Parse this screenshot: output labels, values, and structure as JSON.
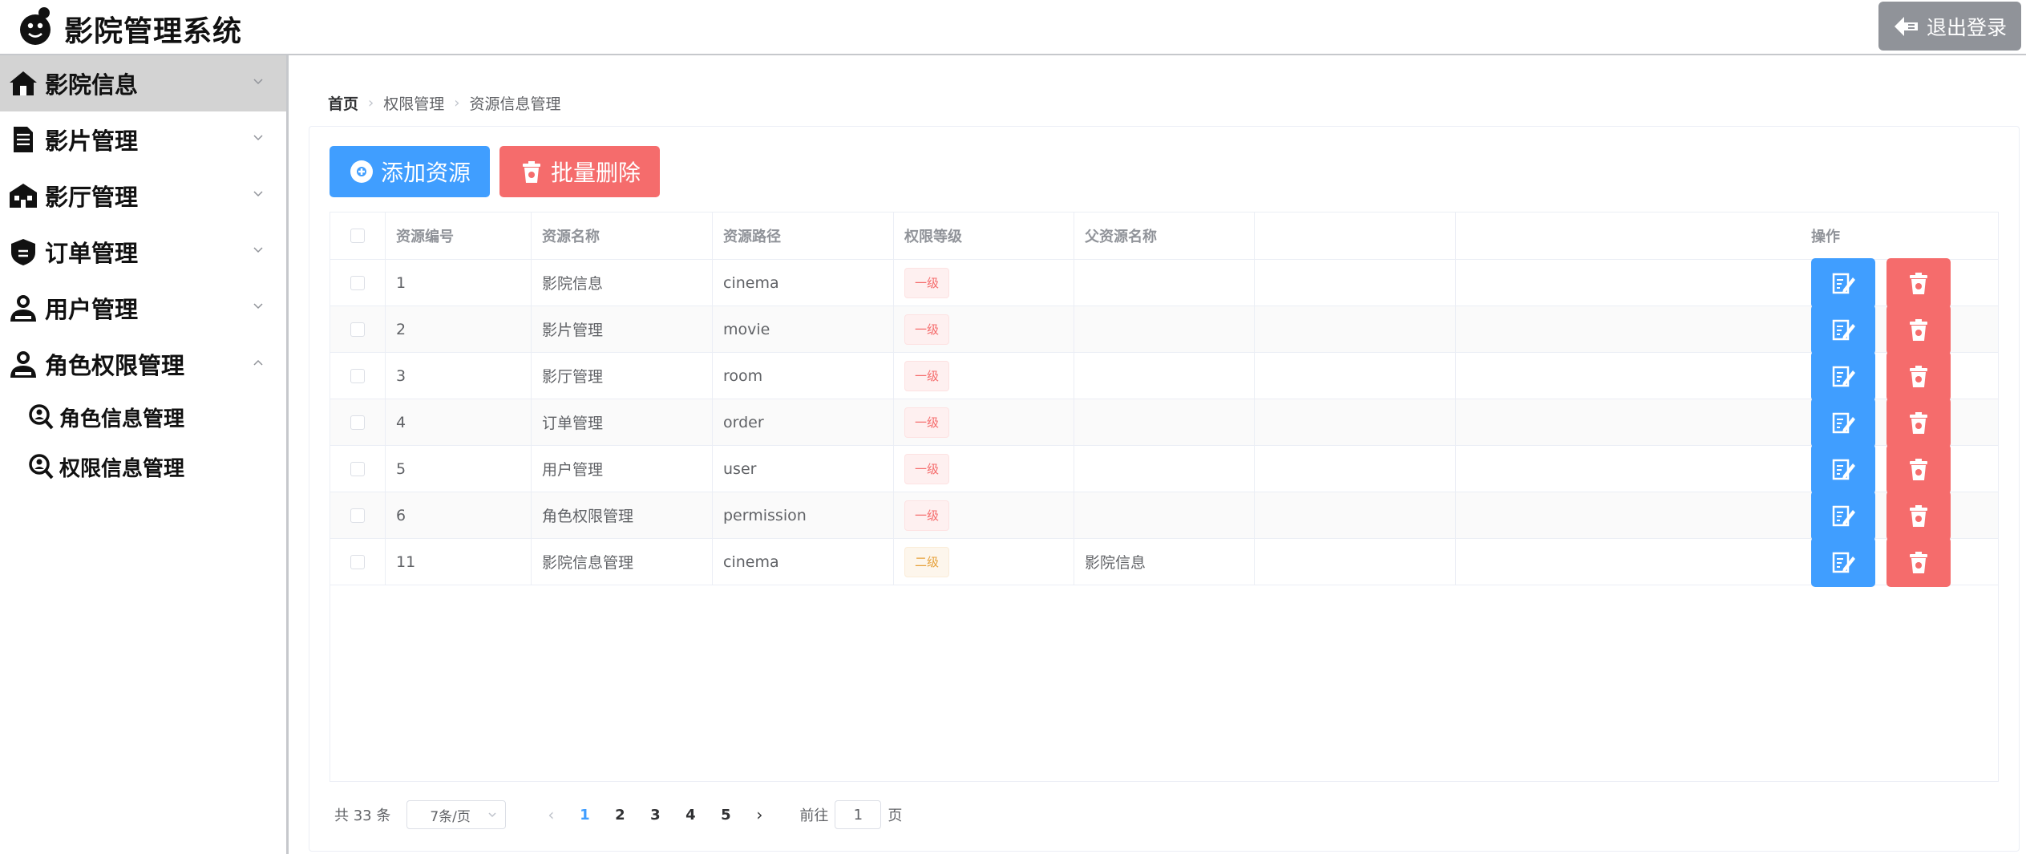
{
  "app": {
    "title": "影院管理系统",
    "logout_label": "退出登录"
  },
  "sidebar": {
    "items": [
      {
        "label": "影院信息",
        "icon": "home-icon",
        "expanded": false,
        "active": true
      },
      {
        "label": "影片管理",
        "icon": "document-icon",
        "expanded": false
      },
      {
        "label": "影厅管理",
        "icon": "building-icon",
        "expanded": false
      },
      {
        "label": "订单管理",
        "icon": "badge-icon",
        "expanded": false
      },
      {
        "label": "用户管理",
        "icon": "user-icon",
        "expanded": false
      },
      {
        "label": "角色权限管理",
        "icon": "user-icon",
        "expanded": true,
        "children": [
          {
            "label": "角色信息管理",
            "icon": "search-user-icon"
          },
          {
            "label": "权限信息管理",
            "icon": "search-user-icon"
          }
        ]
      }
    ]
  },
  "breadcrumb": [
    "首页",
    "权限管理",
    "资源信息管理"
  ],
  "toolbar": {
    "add_label": "添加资源",
    "batch_delete_label": "批量删除"
  },
  "table": {
    "columns": [
      "资源编号",
      "资源名称",
      "资源路径",
      "权限等级",
      "父资源名称",
      "操作"
    ],
    "rows": [
      {
        "id": "1",
        "name": "影院信息",
        "path": "cinema",
        "level": "一级",
        "parent": ""
      },
      {
        "id": "2",
        "name": "影片管理",
        "path": "movie",
        "level": "一级",
        "parent": ""
      },
      {
        "id": "3",
        "name": "影厅管理",
        "path": "room",
        "level": "一级",
        "parent": ""
      },
      {
        "id": "4",
        "name": "订单管理",
        "path": "order",
        "level": "一级",
        "parent": ""
      },
      {
        "id": "5",
        "name": "用户管理",
        "path": "user",
        "level": "一级",
        "parent": ""
      },
      {
        "id": "6",
        "name": "角色权限管理",
        "path": "permission",
        "level": "一级",
        "parent": ""
      },
      {
        "id": "11",
        "name": "影院信息管理",
        "path": "cinema",
        "level": "二级",
        "parent": "影院信息"
      }
    ]
  },
  "pagination": {
    "total_label": "共 33 条",
    "page_size_label": "7条/页",
    "pages": [
      "1",
      "2",
      "3",
      "4",
      "5"
    ],
    "current_page": "1",
    "goto_prefix": "前往",
    "goto_value": "1",
    "goto_suffix": "页"
  },
  "colors": {
    "primary": "#409eff",
    "danger": "#f56c6c",
    "warning": "#e6a23c",
    "info": "#909399"
  }
}
